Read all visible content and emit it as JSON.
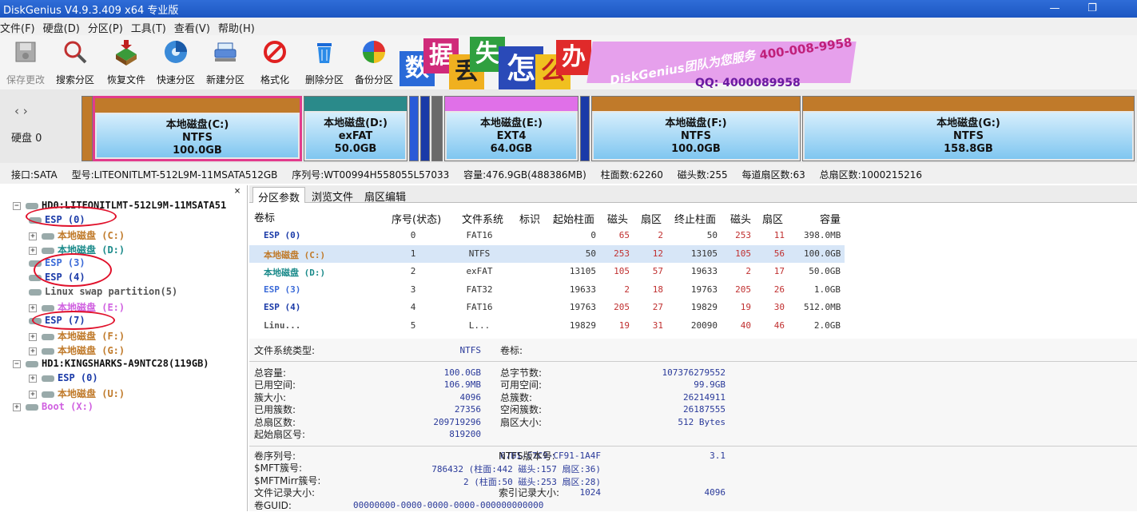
{
  "window": {
    "title": "DiskGenius V4.9.3.409 x64 专业版",
    "restore_glyph": "❐"
  },
  "menu": [
    "文件(F)",
    "硬盘(D)",
    "分区(P)",
    "工具(T)",
    "查看(V)",
    "帮助(H)"
  ],
  "toolbar": [
    {
      "label": "保存更改",
      "icon": "save-icon",
      "enabled": false
    },
    {
      "label": "搜索分区",
      "icon": "search-icon",
      "enabled": true
    },
    {
      "label": "恢复文件",
      "icon": "recover-icon",
      "enabled": true
    },
    {
      "label": "快速分区",
      "icon": "quick-partition-icon",
      "enabled": true
    },
    {
      "label": "新建分区",
      "icon": "new-partition-icon",
      "enabled": true
    },
    {
      "label": "格式化",
      "icon": "format-icon",
      "enabled": true
    },
    {
      "label": "删除分区",
      "icon": "delete-icon",
      "enabled": true
    },
    {
      "label": "备份分区",
      "icon": "backup-icon",
      "enabled": true
    }
  ],
  "banner": {
    "chars": [
      "数",
      "据",
      "丢",
      "失",
      "怎",
      "么",
      "办"
    ],
    "team": "DiskGenius团队为您服务",
    "phone": "400-008-9958",
    "qq": "QQ: 4000089958"
  },
  "disk_nav": {
    "arrows": "‹ ›",
    "label": "硬盘 0"
  },
  "partitions": [
    {
      "name": "本地磁盘(C:)",
      "fs": "NTFS",
      "size": "100.0GB",
      "header_color": "#c07a2a",
      "selected": true
    },
    {
      "name": "本地磁盘(D:)",
      "fs": "exFAT",
      "size": "50.0GB",
      "header_color": "#2a8a8a",
      "selected": false
    },
    {
      "name": "本地磁盘(E:)",
      "fs": "EXT4",
      "size": "64.0GB",
      "header_color": "#e070e8",
      "selected": false
    },
    {
      "name": "本地磁盘(F:)",
      "fs": "NTFS",
      "size": "100.0GB",
      "header_color": "#c07a2a",
      "selected": false
    },
    {
      "name": "本地磁盘(G:)",
      "fs": "NTFS",
      "size": "158.8GB",
      "header_color": "#c07a2a",
      "selected": false
    }
  ],
  "disk_info": {
    "interface": "接口:SATA",
    "model": "型号:LITEONITLMT-512L9M-11MSATA512GB",
    "serial": "序列号:WT00994H558055L57033",
    "capacity": "容量:476.9GB(488386MB)",
    "cylinders": "柱面数:62260",
    "heads": "磁头数:255",
    "sectors_per_track": "每道扇区数:63",
    "total_sectors": "总扇区数:1000215216"
  },
  "tree": {
    "close": "×",
    "items": [
      {
        "label": "HD0:LITEONITLMT-512L9M-11MSATA51",
        "color": "#111",
        "level": 0,
        "exp": "−"
      },
      {
        "label": "ESP (0)",
        "color": "#1a3aa8",
        "level": 1,
        "exp": ""
      },
      {
        "label": "本地磁盘 (C:)",
        "color": "#c07a2a",
        "level": 1,
        "exp": "+"
      },
      {
        "label": "本地磁盘 (D:)",
        "color": "#1a8a8a",
        "level": 1,
        "exp": "+"
      },
      {
        "label": "ESP (3)",
        "color": "#3a6ad8",
        "level": 1,
        "exp": ""
      },
      {
        "label": "ESP (4)",
        "color": "#1a3aa8",
        "level": 1,
        "exp": ""
      },
      {
        "label": "Linux swap partition(5)",
        "color": "#555",
        "level": 1,
        "exp": ""
      },
      {
        "label": "本地磁盘 (E:)",
        "color": "#d060e0",
        "level": 1,
        "exp": "+"
      },
      {
        "label": "ESP (7)",
        "color": "#1a3aa8",
        "level": 1,
        "exp": ""
      },
      {
        "label": "本地磁盘 (F:)",
        "color": "#c07a2a",
        "level": 1,
        "exp": "+"
      },
      {
        "label": "本地磁盘 (G:)",
        "color": "#c07a2a",
        "level": 1,
        "exp": "+"
      },
      {
        "label": "HD1:KINGSHARKS-A9NTC28(119GB)",
        "color": "#111",
        "level": 0,
        "exp": "−"
      },
      {
        "label": "ESP (0)",
        "color": "#1a3aa8",
        "level": 1,
        "exp": "+"
      },
      {
        "label": "本地磁盘 (U:)",
        "color": "#c07a2a",
        "level": 1,
        "exp": "+"
      },
      {
        "label": "Boot (X:)",
        "color": "#d060e0",
        "level": 0,
        "exp": "+"
      }
    ]
  },
  "tabs": [
    "分区参数",
    "浏览文件",
    "扇区编辑"
  ],
  "table": {
    "headers": [
      "卷标",
      "序号(状态)",
      "文件系统",
      "标识",
      "起始柱面",
      "磁头",
      "扇区",
      "终止柱面",
      "磁头",
      "扇区",
      "容量"
    ],
    "rows": [
      {
        "label": "ESP (0)",
        "color": "#1a3aa8",
        "cells": [
          "0",
          "FAT16",
          "",
          "0",
          "65",
          "2",
          "50",
          "253",
          "11",
          "398.0MB"
        ],
        "selected": false
      },
      {
        "label": "本地磁盘 (C:)",
        "color": "#c07a2a",
        "cells": [
          "1",
          "NTFS",
          "",
          "50",
          "253",
          "12",
          "13105",
          "105",
          "56",
          "100.0GB"
        ],
        "selected": true
      },
      {
        "label": "本地磁盘 (D:)",
        "color": "#1a8a8a",
        "cells": [
          "2",
          "exFAT",
          "",
          "13105",
          "105",
          "57",
          "19633",
          "2",
          "17",
          "50.0GB"
        ],
        "selected": false
      },
      {
        "label": "ESP (3)",
        "color": "#3a6ad8",
        "cells": [
          "3",
          "FAT32",
          "",
          "19633",
          "2",
          "18",
          "19763",
          "205",
          "26",
          "1.0GB"
        ],
        "selected": false
      },
      {
        "label": "ESP (4)",
        "color": "#1a3aa8",
        "cells": [
          "4",
          "FAT16",
          "",
          "19763",
          "205",
          "27",
          "19829",
          "19",
          "30",
          "512.0MB"
        ],
        "selected": false
      },
      {
        "label": "Linu...",
        "color": "#555",
        "cells": [
          "5",
          "L...",
          "",
          "19829",
          "19",
          "31",
          "20090",
          "40",
          "46",
          "2.0GB"
        ],
        "selected": false
      }
    ]
  },
  "details": {
    "fs_type_label": "文件系统类型:",
    "fs_type": "NTFS",
    "vol_label": "卷标:",
    "left": [
      {
        "k": "总容量:",
        "v": "100.0GB"
      },
      {
        "k": "已用空间:",
        "v": "106.9MB"
      },
      {
        "k": "簇大小:",
        "v": "4096"
      },
      {
        "k": "已用簇数:",
        "v": "27356"
      },
      {
        "k": "总扇区数:",
        "v": "209719296"
      },
      {
        "k": "起始扇区号:",
        "v": "819200"
      }
    ],
    "right": [
      {
        "k": "总字节数:",
        "v": "107376279552"
      },
      {
        "k": "可用空间:",
        "v": "99.9GB"
      },
      {
        "k": "总簇数:",
        "v": "26214911"
      },
      {
        "k": "空闲簇数:",
        "v": "26187555"
      },
      {
        "k": "扇区大小:",
        "v": "512 Bytes"
      }
    ],
    "bottom": [
      {
        "k": "卷序列号:",
        "v": "67B1-C7C9-CF91-1A4F"
      },
      {
        "k": "$MFT簇号:",
        "v": "786432 (柱面:442 磁头:157 扇区:36)"
      },
      {
        "k": "$MFTMirr簇号:",
        "v": "2 (柱面:50 磁头:253 扇区:28)"
      },
      {
        "k": "文件记录大小:",
        "v": "1024"
      },
      {
        "k": "卷GUID:",
        "v": "00000000-0000-0000-0000-000000000000"
      }
    ],
    "ntfs_ver_label": "NTFS版本号:",
    "ntfs_ver": "3.1",
    "index_size_label": "索引记录大小:",
    "index_size": "4096"
  }
}
